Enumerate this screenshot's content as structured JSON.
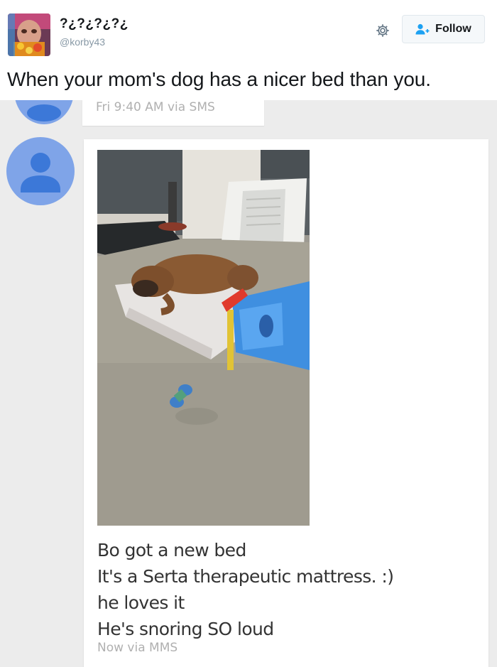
{
  "tweet": {
    "display_name": "?¿?¿?¿?¿",
    "handle": "@korby43",
    "follow_label": "Follow",
    "text": "When your mom's dog has a nicer bed than you."
  },
  "sms": {
    "previous_message_meta": "Fri 9:40 AM via SMS",
    "message_lines": [
      "Bo got a new bed",
      "It's a Serta therapeutic mattress. :)",
      "he loves it",
      "He's snoring SO loud"
    ],
    "message_meta": "Now via MMS"
  },
  "icons": {
    "gear": "gear-icon",
    "follow": "add-user-icon",
    "contact_avatar": "person-icon"
  },
  "colors": {
    "follow_button_bg": "#f5f8fa",
    "handle": "#8899a6",
    "contact_avatar": "#7fa4e8",
    "sms_background": "#ececec",
    "meta_text": "#b0b0b0",
    "follow_icon": "#1da1f2"
  }
}
